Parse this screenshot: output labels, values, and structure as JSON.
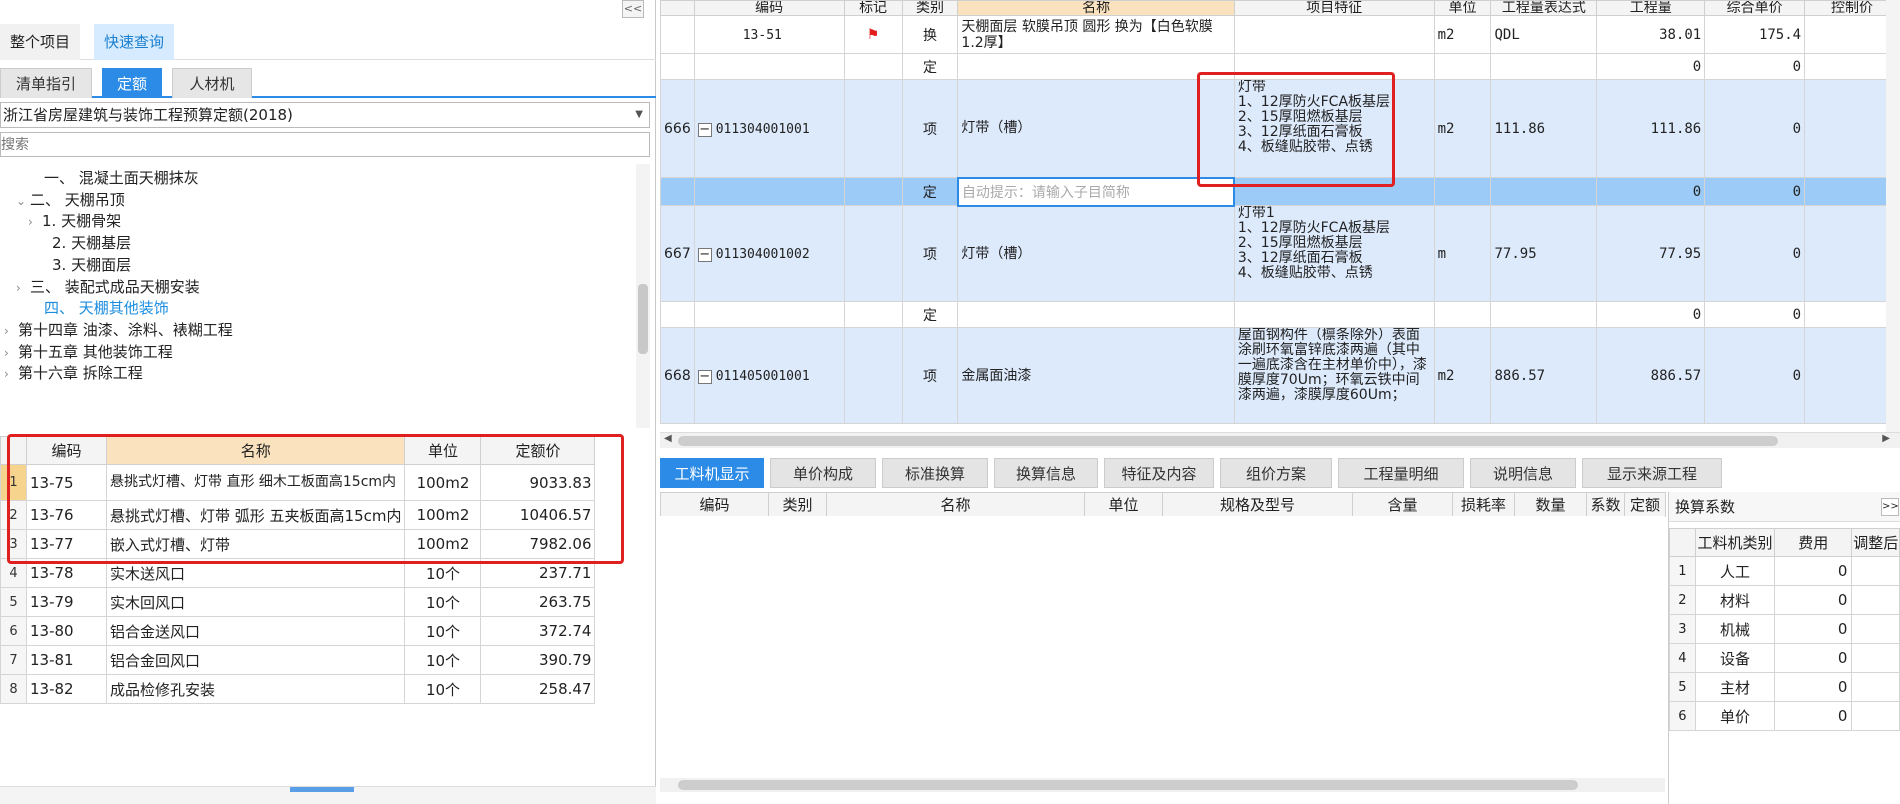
{
  "left": {
    "collapse_label": "<<",
    "scope_tabs": [
      "整个项目",
      "快速查询"
    ],
    "lib_tabs": [
      "清单指引",
      "定额",
      "人材机"
    ],
    "library_select": "浙江省房屋建筑与装饰工程预算定额(2018)",
    "search_placeholder": "搜索",
    "tree": [
      {
        "label": "一、 混凝土面天棚抹灰",
        "caret": ""
      },
      {
        "label": "二、 天棚吊顶",
        "caret": "⌄"
      },
      {
        "label": "1. 天棚骨架",
        "caret": "›"
      },
      {
        "label": "2. 天棚基层",
        "caret": ""
      },
      {
        "label": "3. 天棚面层",
        "caret": ""
      },
      {
        "label": "三、 装配式成品天棚安装",
        "caret": "›"
      },
      {
        "label": "四、 天棚其他装饰",
        "caret": ""
      },
      {
        "label": "第十四章 油漆、涂料、裱糊工程",
        "caret": "›"
      },
      {
        "label": "第十五章 其他装饰工程",
        "caret": "›"
      },
      {
        "label": "第十六章 拆除工程",
        "caret": "›"
      }
    ],
    "quota_headers": [
      "编码",
      "名称",
      "单位",
      "定额价"
    ],
    "quota_rows": [
      {
        "idx": "1",
        "code": "13-75",
        "name": "悬挑式灯槽、灯带 直形 细木工板面高15cm内",
        "unit": "100m2",
        "price": "9033.83"
      },
      {
        "idx": "2",
        "code": "13-76",
        "name": "悬挑式灯槽、灯带 弧形 五夹板面高15cm内",
        "unit": "100m2",
        "price": "10406.57"
      },
      {
        "idx": "3",
        "code": "13-77",
        "name": "嵌入式灯槽、灯带",
        "unit": "100m2",
        "price": "7982.06"
      },
      {
        "idx": "4",
        "code": "13-78",
        "name": "实木送风口",
        "unit": "10个",
        "price": "237.71"
      },
      {
        "idx": "5",
        "code": "13-79",
        "name": "实木回风口",
        "unit": "10个",
        "price": "263.75"
      },
      {
        "idx": "6",
        "code": "13-80",
        "name": "铝合金送风口",
        "unit": "10个",
        "price": "372.74"
      },
      {
        "idx": "7",
        "code": "13-81",
        "name": "铝合金回风口",
        "unit": "10个",
        "price": "390.79"
      },
      {
        "idx": "8",
        "code": "13-82",
        "name": "成品检修孔安装",
        "unit": "10个",
        "price": "258.47"
      }
    ]
  },
  "grid": {
    "headers": [
      "",
      "编码",
      "标记",
      "类别",
      "名称",
      "项目特征",
      "单位",
      "工程量表达式",
      "工程量",
      "综合单价",
      "控制价"
    ],
    "rows": [
      {
        "kind": "white",
        "no": "",
        "code": "13-51",
        "flag": "⚑",
        "type": "换",
        "name": "天棚面层 软膜吊顶 圆形  换为【白色软膜1.2厚】",
        "feature": "",
        "unit": "m2",
        "expr": "QDL",
        "qty": "38.01",
        "price": "175.4"
      },
      {
        "kind": "white",
        "no": "",
        "code": "",
        "flag": "",
        "type": "定",
        "name": "",
        "feature": "",
        "unit": "",
        "expr": "",
        "qty": "0",
        "price": "0"
      },
      {
        "kind": "blue",
        "no": "666",
        "code": "011304001001",
        "flag": "",
        "type": "项",
        "name": "灯带（槽）",
        "feature": "灯带\n1、12厚防火FCA板基层\n2、15厚阻燃板基层\n3、12厚纸面石膏板\n4、板缝贴胶带、点锈",
        "unit": "m2",
        "expr": "111.86",
        "qty": "111.86",
        "price": "0"
      },
      {
        "kind": "sel",
        "no": "",
        "code": "",
        "flag": "",
        "type": "定",
        "name": "",
        "placeholder": "自动提示：请输入子目简称",
        "feature": "",
        "unit": "",
        "expr": "",
        "qty": "0",
        "price": "0"
      },
      {
        "kind": "blue",
        "no": "667",
        "code": "011304001002",
        "flag": "",
        "type": "项",
        "name": "灯带（槽）",
        "feature": "灯带1\n1、12厚防火FCA板基层\n2、15厚阻燃板基层\n3、12厚纸面石膏板\n4、板缝贴胶带、点锈",
        "unit": "m",
        "expr": "77.95",
        "qty": "77.95",
        "price": "0"
      },
      {
        "kind": "white",
        "no": "",
        "code": "",
        "flag": "",
        "type": "定",
        "name": "",
        "feature": "",
        "unit": "",
        "expr": "",
        "qty": "0",
        "price": "0"
      },
      {
        "kind": "blue",
        "no": "668",
        "code": "011405001001",
        "flag": "",
        "type": "项",
        "name": "金属面油漆",
        "feature": "屋面钢构件（檩条除外）表面涂刷环氧富锌底漆两遍（其中一遍底漆含在主材单价中），漆膜厚度70Um；环氧云铁中间漆两遍，漆膜厚度60Um；",
        "unit": "m2",
        "expr": "886.57",
        "qty": "886.57",
        "price": "0"
      }
    ]
  },
  "bottom_tabs": [
    "工料机显示",
    "单价构成",
    "标准换算",
    "换算信息",
    "特征及内容",
    "组价方案",
    "工程量明细",
    "说明信息",
    "显示来源工程"
  ],
  "detail_headers": [
    "编码",
    "类别",
    "名称",
    "单位",
    "规格及型号",
    "含量",
    "损耗率",
    "数量",
    "系数",
    "定额"
  ],
  "coef": {
    "title": "换算系数",
    "toggle": ">>",
    "headers": [
      "",
      "工料机类别",
      "费用",
      "调整后"
    ],
    "rows": [
      {
        "idx": "1",
        "cat": "人工",
        "fee": "0"
      },
      {
        "idx": "2",
        "cat": "材料",
        "fee": "0"
      },
      {
        "idx": "3",
        "cat": "机械",
        "fee": "0"
      },
      {
        "idx": "4",
        "cat": "设备",
        "fee": "0"
      },
      {
        "idx": "5",
        "cat": "主材",
        "fee": "0"
      },
      {
        "idx": "6",
        "cat": "单价",
        "fee": "0"
      }
    ]
  },
  "colors": {
    "accent": "#2b8be6",
    "highlight_box": "#e02020",
    "name_header": "#fbe2bf",
    "row_blue": "#ddeafc",
    "row_selected": "#9ccbf7"
  }
}
